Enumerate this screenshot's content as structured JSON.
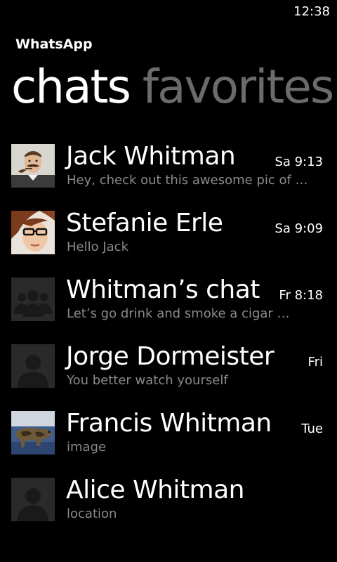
{
  "status_bar": {
    "time": "12:38"
  },
  "app": {
    "title": "WhatsApp"
  },
  "pivot": {
    "tabs": [
      {
        "label": "chats",
        "active": true
      },
      {
        "label": "favorites",
        "active": false
      }
    ]
  },
  "chats": [
    {
      "name": "Jack Whitman",
      "preview": "Hey, check out this awesome pic of …",
      "time": "Sa 9:13",
      "avatar": "man-with-pipe-photo"
    },
    {
      "name": "Stefanie Erle",
      "preview": "Hello Jack",
      "time": "Sa 9:09",
      "avatar": "woman-with-glasses-photo"
    },
    {
      "name": "Whitman’s chat",
      "preview": "Let’s go drink and smoke a cigar …",
      "time": "Fr 8:18",
      "avatar": "group-placeholder-icon"
    },
    {
      "name": "Jorge Dormeister",
      "preview": "You better watch yourself",
      "time": "Fri",
      "avatar": "person-placeholder-icon"
    },
    {
      "name": "Francis Whitman",
      "preview": "image",
      "time": "Tue",
      "avatar": "dog-photo"
    },
    {
      "name": "Alice Whitman",
      "preview": "location",
      "time": "",
      "avatar": "person-placeholder-icon"
    }
  ],
  "colors": {
    "background": "#000000",
    "text_primary": "#ffffff",
    "text_secondary": "#8a8a8a",
    "tab_inactive": "#6b6b6b",
    "placeholder_bg": "#2a2a2a",
    "placeholder_fg": "#1a1a1a"
  }
}
